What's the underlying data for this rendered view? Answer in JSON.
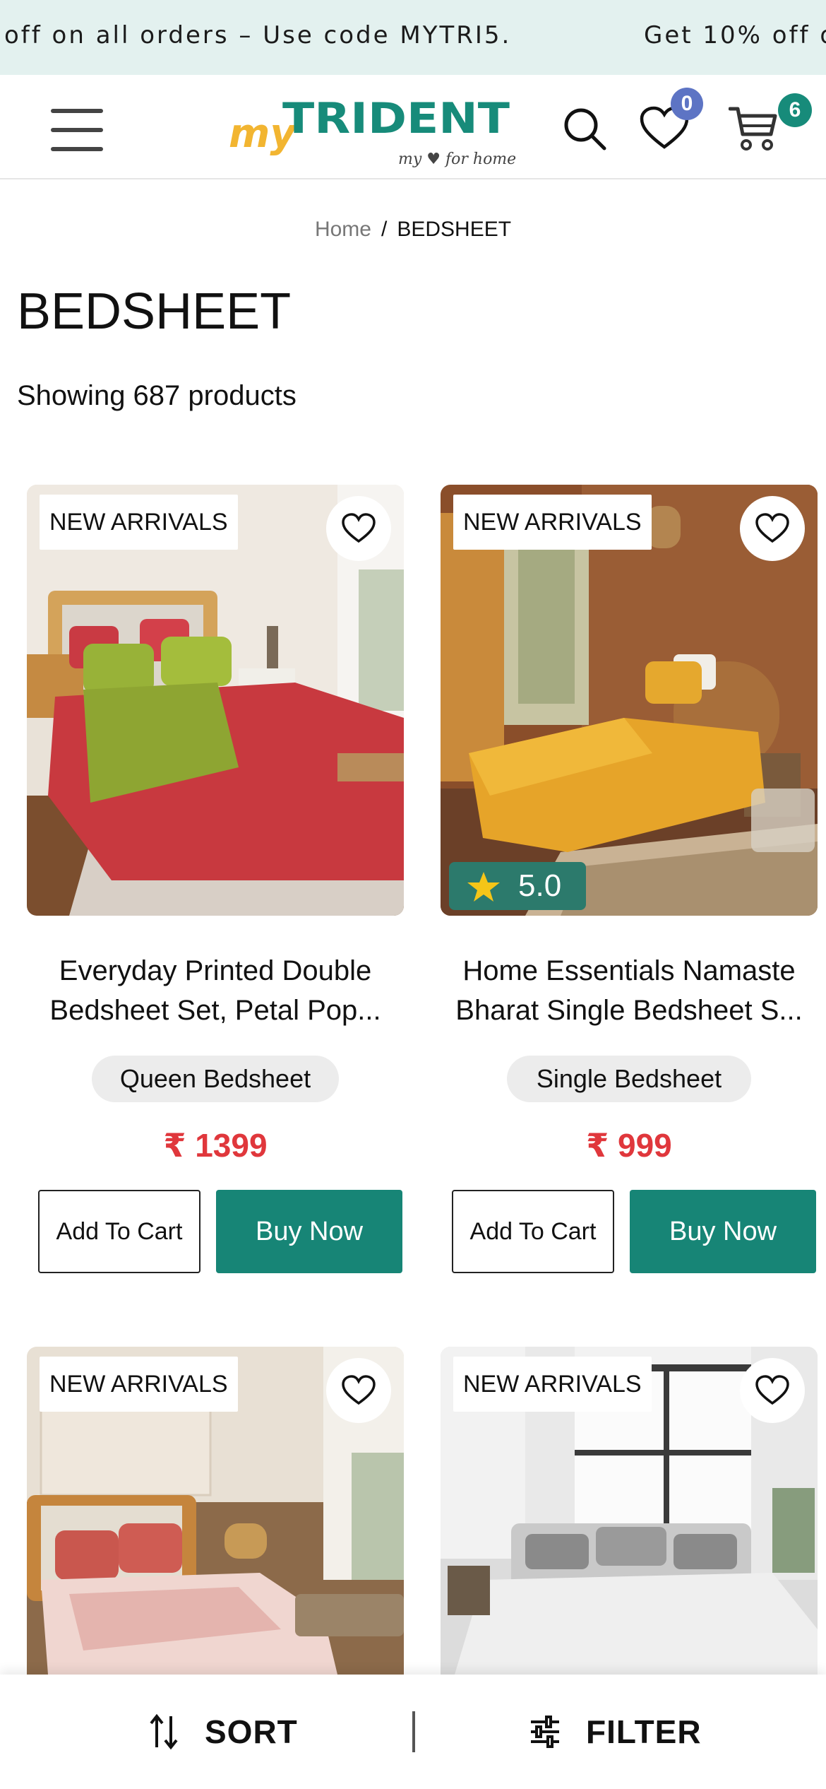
{
  "announcement": {
    "message_1": "off on all orders – Use code MYTRI5.",
    "message_2": "Get 10% off o"
  },
  "header": {
    "logo": {
      "my": "my",
      "brand": "TRIDENT",
      "tagline": "my ♥ for home"
    },
    "wishlist_count": "0",
    "cart_count": "6",
    "icons": [
      "menu-icon",
      "search-icon",
      "heart-icon",
      "cart-icon"
    ]
  },
  "breadcrumb": {
    "home": "Home",
    "separator": "/",
    "current": "BEDSHEET"
  },
  "page_title": "BEDSHEET",
  "product_count_text": "Showing 687 products",
  "colors": {
    "accent": "#178576",
    "price": "#e0373c",
    "announce_bg": "#e3f1ef",
    "wish_badge": "#5d74c4",
    "cart_badge": "#178b7a"
  },
  "products": [
    {
      "tag": "NEW ARRIVALS",
      "name_line1": "Everyday Printed Double",
      "name_line2": "Bedsheet Set, Petal Pop...",
      "category": "Queen Bedsheet",
      "price": "₹ 1399",
      "add_to_cart": "Add To Cart",
      "buy_now": "Buy Now"
    },
    {
      "tag": "NEW ARRIVALS",
      "rating": "5.0",
      "name_line1": "Home Essentials Namaste",
      "name_line2": "Bharat Single Bedsheet S...",
      "category": "Single Bedsheet",
      "price": "₹ 999",
      "add_to_cart": "Add To Cart",
      "buy_now": "Buy Now"
    },
    {
      "tag": "NEW ARRIVALS"
    },
    {
      "tag": "NEW ARRIVALS"
    }
  ],
  "bottom_bar": {
    "sort_label": "SORT",
    "filter_label": "FILTER"
  }
}
